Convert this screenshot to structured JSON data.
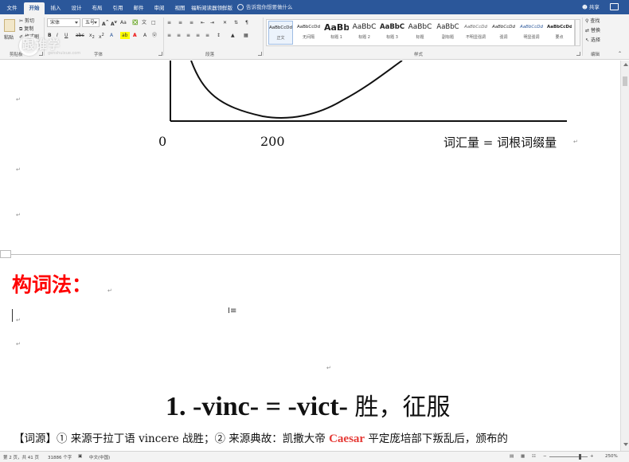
{
  "ribbon": {
    "tabs": [
      "文件",
      "开始",
      "插入",
      "设计",
      "布局",
      "引用",
      "邮件",
      "审阅",
      "视图",
      "福昕阅读器领鲜版"
    ],
    "active_tab": "开始",
    "tell_me": "告诉我你想要做什么",
    "user": "共享",
    "clipboard": {
      "paste": "粘贴",
      "cut": "剪切",
      "copy": "复制",
      "format_painter": "格式刷",
      "label": "剪贴板"
    },
    "font": {
      "name": "宋体",
      "size": "五号",
      "label": "字体"
    },
    "paragraph": {
      "label": "段落"
    },
    "styles": {
      "label": "样式",
      "items": [
        {
          "preview": "AaBbCcDd",
          "name": "正文"
        },
        {
          "preview": "AaBbCcDd",
          "name": "无间隔"
        },
        {
          "preview": "AaBb",
          "name": "标题 1"
        },
        {
          "preview": "AaBbC",
          "name": "标题 2"
        },
        {
          "preview": "AaBbC",
          "name": "标题 3"
        },
        {
          "preview": "AaBbC",
          "name": "标题"
        },
        {
          "preview": "AaBbC",
          "name": "副标题"
        },
        {
          "preview": "AaBbCcDd",
          "name": "不明显强调"
        },
        {
          "preview": "AaBbCcDd",
          "name": "强调"
        },
        {
          "preview": "AaBbCcDd",
          "name": "明显强调"
        },
        {
          "preview": "AaBbCcDd",
          "name": "要点"
        }
      ]
    },
    "editing": {
      "find": "查找",
      "replace": "替换",
      "select": "选择",
      "label": "编辑"
    }
  },
  "watermark": {
    "text": "跟谁学",
    "sub": "genshuixue.com"
  },
  "document": {
    "chart_ticks": [
      "0",
      "200"
    ],
    "formula": "词汇量 = 词根词缀量",
    "section_title": "构词法：",
    "heading": {
      "latin": "1. -vinc- = -vict-",
      "cn": "胜，征服"
    },
    "etymology": {
      "before": "【词源】① 来源于拉丁语 vincere 战胜；② 来源典故：凯撒大帝 ",
      "highlight": "Caesar",
      "after": " 平定庞培部下叛乱后，颁布的"
    }
  },
  "status": {
    "page": "第 2 页，共 41 页",
    "words": "31886 个字",
    "lang": "中文(中国)",
    "zoom": "250%"
  }
}
